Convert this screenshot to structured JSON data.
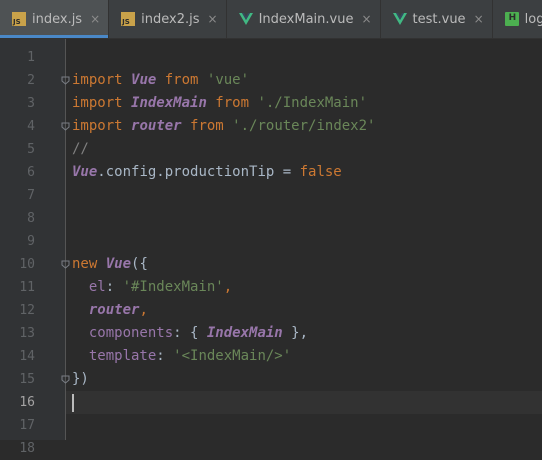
{
  "tabs": [
    {
      "label": "index.js",
      "icon": "js-file-icon",
      "active": true
    },
    {
      "label": "index2.js",
      "icon": "js-file-icon",
      "active": false
    },
    {
      "label": "IndexMain.vue",
      "icon": "vue-file-icon",
      "active": false
    },
    {
      "label": "test.vue",
      "icon": "vue-file-icon",
      "active": false
    },
    {
      "label": "login.htm",
      "icon": "html-file-icon",
      "active": false
    }
  ],
  "tab_close_glyph": "×",
  "colors": {
    "background": "#2b2b2b",
    "keyword": "#cc7832",
    "string": "#6a8759",
    "property": "#9876aa",
    "text": "#a9b7c6",
    "vue_icon": "#41b883",
    "active_tab_underline": "#4a88c7"
  },
  "editor": {
    "current_line": 16,
    "lines": [
      {
        "n": "1",
        "fold": false,
        "tokens": []
      },
      {
        "n": "2",
        "fold": true,
        "tokens": [
          {
            "t": "import ",
            "c": "kw"
          },
          {
            "t": "Vue",
            "c": "cls"
          },
          {
            "t": " from ",
            "c": "kw"
          },
          {
            "t": "'vue'",
            "c": "str"
          }
        ]
      },
      {
        "n": "3",
        "fold": false,
        "tokens": [
          {
            "t": "import ",
            "c": "kw"
          },
          {
            "t": "IndexMain",
            "c": "cls"
          },
          {
            "t": " from ",
            "c": "kw"
          },
          {
            "t": "'./IndexMain'",
            "c": "str"
          }
        ]
      },
      {
        "n": "4",
        "fold": true,
        "tokens": [
          {
            "t": "import ",
            "c": "kw"
          },
          {
            "t": "router",
            "c": "cls"
          },
          {
            "t": " from ",
            "c": "kw"
          },
          {
            "t": "'./router/index2'",
            "c": "str"
          }
        ]
      },
      {
        "n": "5",
        "fold": false,
        "tokens": [
          {
            "t": "//",
            "c": "cmt"
          }
        ]
      },
      {
        "n": "6",
        "fold": false,
        "tokens": [
          {
            "t": "Vue",
            "c": "cls"
          },
          {
            "t": ".config.productionTip = ",
            "c": "def"
          },
          {
            "t": "false",
            "c": "kw"
          }
        ]
      },
      {
        "n": "7",
        "fold": false,
        "tokens": []
      },
      {
        "n": "8",
        "fold": false,
        "tokens": []
      },
      {
        "n": "9",
        "fold": false,
        "tokens": []
      },
      {
        "n": "10",
        "fold": true,
        "tokens": [
          {
            "t": "new ",
            "c": "kw"
          },
          {
            "t": "Vue",
            "c": "cls"
          },
          {
            "t": "({",
            "c": "def"
          }
        ]
      },
      {
        "n": "11",
        "fold": false,
        "tokens": [
          {
            "t": "  el",
            "c": "prop"
          },
          {
            "t": ": ",
            "c": "def"
          },
          {
            "t": "'#IndexMain'",
            "c": "str"
          },
          {
            "t": ",",
            "c": "kw"
          }
        ]
      },
      {
        "n": "12",
        "fold": false,
        "tokens": [
          {
            "t": "  ",
            "c": "def"
          },
          {
            "t": "router",
            "c": "cls"
          },
          {
            "t": ",",
            "c": "kw"
          }
        ]
      },
      {
        "n": "13",
        "fold": false,
        "tokens": [
          {
            "t": "  components",
            "c": "prop"
          },
          {
            "t": ": { ",
            "c": "def"
          },
          {
            "t": "IndexMain",
            "c": "cls"
          },
          {
            "t": " },",
            "c": "def"
          }
        ]
      },
      {
        "n": "14",
        "fold": false,
        "tokens": [
          {
            "t": "  template",
            "c": "prop"
          },
          {
            "t": ": ",
            "c": "def"
          },
          {
            "t": "'<IndexMain/>'",
            "c": "str"
          }
        ]
      },
      {
        "n": "15",
        "fold": true,
        "tokens": [
          {
            "t": "})",
            "c": "def"
          }
        ]
      },
      {
        "n": "16",
        "fold": false,
        "tokens": []
      },
      {
        "n": "17",
        "fold": false,
        "tokens": []
      },
      {
        "n": "18",
        "fold": false,
        "tokens": []
      }
    ]
  }
}
